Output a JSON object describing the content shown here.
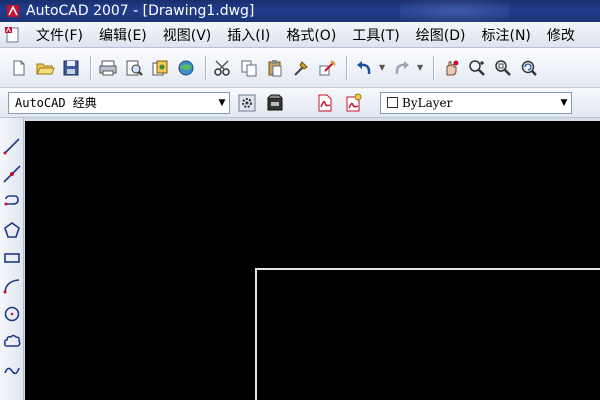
{
  "window": {
    "title": "AutoCAD 2007 - [Drawing1.dwg]"
  },
  "menu": {
    "items": [
      {
        "label": "文件(F)"
      },
      {
        "label": "编辑(E)"
      },
      {
        "label": "视图(V)"
      },
      {
        "label": "插入(I)"
      },
      {
        "label": "格式(O)"
      },
      {
        "label": "工具(T)"
      },
      {
        "label": "绘图(D)"
      },
      {
        "label": "标注(N)"
      },
      {
        "label": "修改"
      }
    ]
  },
  "workspace": {
    "selected": "AutoCAD 经典"
  },
  "layer": {
    "selected": "ByLayer"
  },
  "colors": {
    "canvas": "#000000",
    "titlebar": "#1f3a86",
    "paper_border": "#e6e6e6"
  },
  "icons": {
    "standard_toolbar": [
      "new-icon",
      "open-icon",
      "save-icon",
      "plot-icon",
      "plot-preview-icon",
      "publish-icon",
      "3d-dwf-icon",
      "cut-icon",
      "copy-icon",
      "paste-icon",
      "match-properties-icon",
      "block-editor-icon",
      "undo-icon",
      "redo-icon",
      "pan-icon",
      "zoom-realtime-icon",
      "zoom-window-icon",
      "zoom-previous-icon"
    ],
    "draw_toolbar": [
      "line-icon",
      "construction-line-icon",
      "polyline-icon",
      "polygon-icon",
      "rectangle-icon",
      "arc-icon",
      "circle-icon",
      "revision-cloud-icon",
      "spline-icon"
    ]
  }
}
